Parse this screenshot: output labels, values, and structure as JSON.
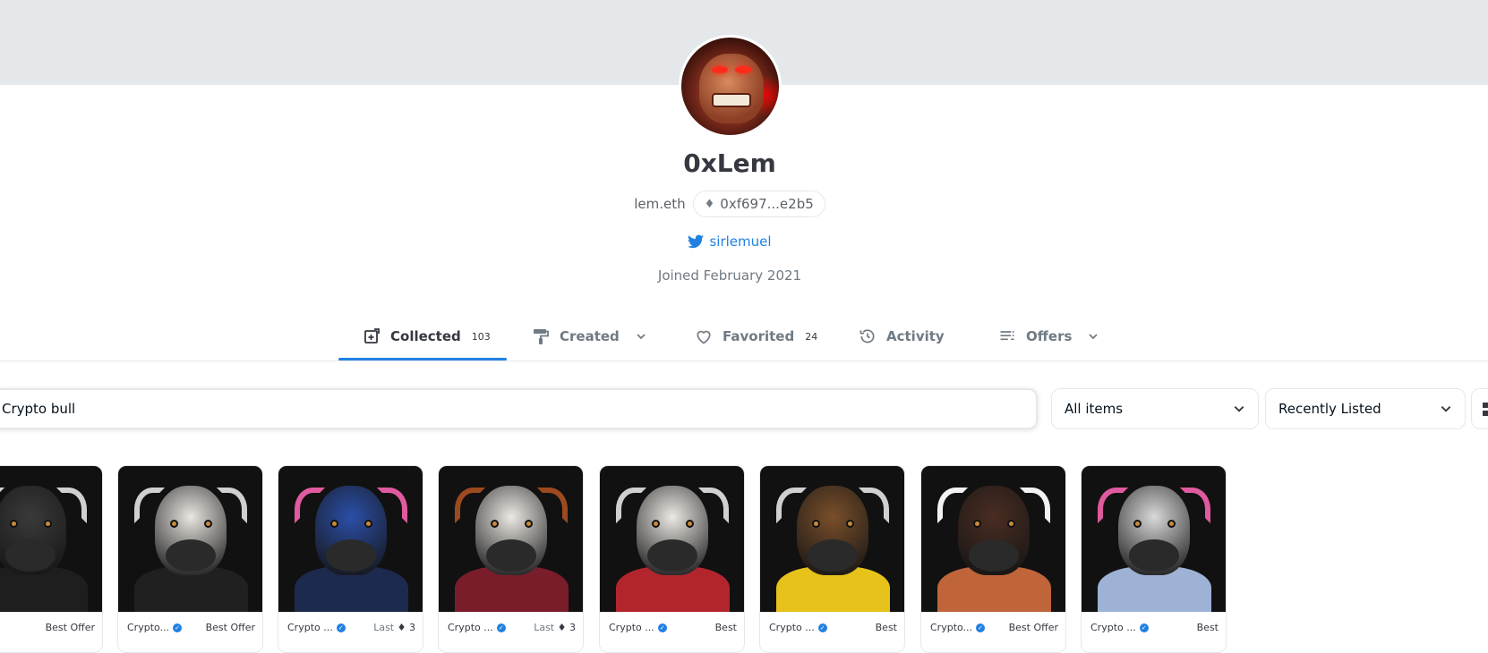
{
  "profile": {
    "name": "0xLem",
    "ens": "lem.eth",
    "address": "0xf697...e2b5",
    "twitter": "sirlemuel",
    "joined": "Joined February 2021"
  },
  "tabs": [
    {
      "label": "Collected",
      "count": "103",
      "icon": "collected-icon",
      "active": true
    },
    {
      "label": "Created",
      "count": "",
      "icon": "paint-roller-icon",
      "dropdown": true
    },
    {
      "label": "Favorited",
      "count": "24",
      "icon": "heart-icon"
    },
    {
      "label": "Activity",
      "count": "",
      "icon": "history-icon"
    },
    {
      "label": "Offers",
      "count": "",
      "icon": "list-icon",
      "dropdown": true
    }
  ],
  "filters": {
    "search_value": "Crypto bull",
    "items_select": "All items",
    "sort_select": "Recently Listed"
  },
  "cards": [
    {
      "collection": "...",
      "price": "Best Offer",
      "palette": {
        "head": "#3a3a3a",
        "body": "#1e1e1e",
        "horn": "#d0d0d0"
      }
    },
    {
      "collection": "Crypto...",
      "price": "Best Offer",
      "palette": {
        "head": "#e9e6e1",
        "body": "#202020",
        "horn": "#d0d0d0"
      }
    },
    {
      "collection": "Crypto ...",
      "price_label": "Last",
      "price": "3",
      "palette": {
        "head": "#2b4fa8",
        "body": "#1c2a4d",
        "horn": "#e05aa0"
      }
    },
    {
      "collection": "Crypto ...",
      "price_label": "Last",
      "price": "3",
      "palette": {
        "head": "#ece9e4",
        "body": "#7a1d2b",
        "horn": "#9c4a20"
      }
    },
    {
      "collection": "Crypto ...",
      "price": "Best",
      "palette": {
        "head": "#ece9e4",
        "body": "#b3252d",
        "horn": "#d0d0d0"
      }
    },
    {
      "collection": "Crypto ...",
      "price": "Best",
      "palette": {
        "head": "#7a4f2a",
        "body": "#e6c21a",
        "horn": "#d0d0d0"
      }
    },
    {
      "collection": "Crypto...",
      "price": "Best Offer",
      "palette": {
        "head": "#4a2d22",
        "body": "#c0653a",
        "horn": "#f2f2f2"
      }
    },
    {
      "collection": "Crypto ...",
      "price": "Best",
      "palette": {
        "head": "#d9d9d9",
        "body": "#9eb2d6",
        "horn": "#e05aa0"
      }
    }
  ],
  "colors": {
    "accent": "#2081e2",
    "banner": "#e5e8eb",
    "text": "#353840"
  }
}
